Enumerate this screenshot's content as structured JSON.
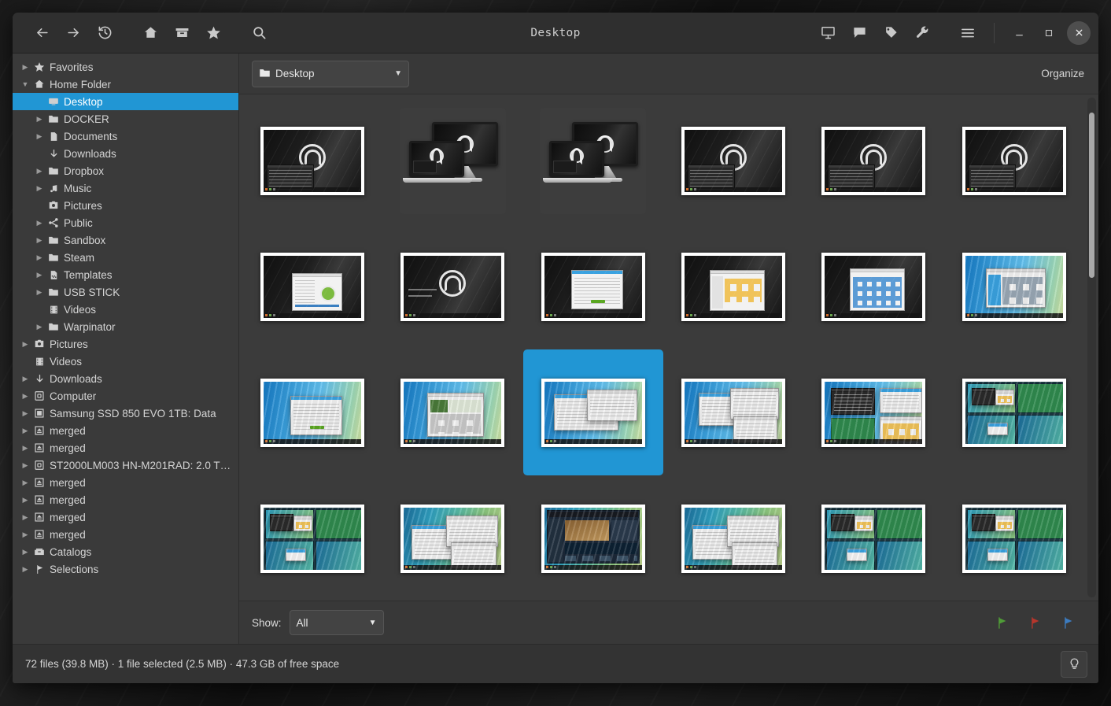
{
  "window": {
    "title": "Desktop",
    "titlebar_left_icons": [
      "back-icon",
      "forward-icon",
      "history-icon",
      "home-icon",
      "archive-icon",
      "star-icon",
      "search-icon"
    ],
    "titlebar_right_icons": [
      "presentation-icon",
      "comment-icon",
      "tag-icon",
      "wrench-icon",
      "menu-icon"
    ],
    "controls": [
      "minimize-button",
      "maximize-button",
      "close-button"
    ]
  },
  "sidebar": {
    "items": [
      {
        "label": "Favorites",
        "icon": "star-icon",
        "indent": 0,
        "arrow": "right",
        "selected": false
      },
      {
        "label": "Home Folder",
        "icon": "home-icon",
        "indent": 0,
        "arrow": "down",
        "selected": false
      },
      {
        "label": "Desktop",
        "icon": "desktop-icon",
        "indent": 1,
        "arrow": "none",
        "selected": true
      },
      {
        "label": "DOCKER",
        "icon": "folder-icon",
        "indent": 1,
        "arrow": "right",
        "selected": false
      },
      {
        "label": "Documents",
        "icon": "document-icon",
        "indent": 1,
        "arrow": "right",
        "selected": false
      },
      {
        "label": "Downloads",
        "icon": "download-icon",
        "indent": 1,
        "arrow": "none",
        "selected": false
      },
      {
        "label": "Dropbox",
        "icon": "folder-icon",
        "indent": 1,
        "arrow": "right",
        "selected": false
      },
      {
        "label": "Music",
        "icon": "music-icon",
        "indent": 1,
        "arrow": "right",
        "selected": false
      },
      {
        "label": "Pictures",
        "icon": "camera-icon",
        "indent": 1,
        "arrow": "none",
        "selected": false
      },
      {
        "label": "Public",
        "icon": "share-icon",
        "indent": 1,
        "arrow": "right",
        "selected": false
      },
      {
        "label": "Sandbox",
        "icon": "folder-icon",
        "indent": 1,
        "arrow": "right",
        "selected": false
      },
      {
        "label": "Steam",
        "icon": "folder-icon",
        "indent": 1,
        "arrow": "right",
        "selected": false
      },
      {
        "label": "Templates",
        "icon": "template-icon",
        "indent": 1,
        "arrow": "right",
        "selected": false
      },
      {
        "label": "USB STICK",
        "icon": "folder-icon",
        "indent": 1,
        "arrow": "right",
        "selected": false
      },
      {
        "label": "Videos",
        "icon": "film-icon",
        "indent": 1,
        "arrow": "none",
        "selected": false
      },
      {
        "label": "Warpinator",
        "icon": "folder-icon",
        "indent": 1,
        "arrow": "right",
        "selected": false
      },
      {
        "label": "Pictures",
        "icon": "camera-icon",
        "indent": 0,
        "arrow": "right",
        "selected": false
      },
      {
        "label": "Videos",
        "icon": "film-icon",
        "indent": 0,
        "arrow": "none",
        "selected": false
      },
      {
        "label": "Downloads",
        "icon": "download-icon",
        "indent": 0,
        "arrow": "right",
        "selected": false
      },
      {
        "label": "Computer",
        "icon": "drive-icon",
        "indent": 0,
        "arrow": "right",
        "selected": false
      },
      {
        "label": "Samsung SSD 850 EVO 1TB: Data",
        "icon": "chip-icon",
        "indent": 0,
        "arrow": "right",
        "selected": false
      },
      {
        "label": "merged",
        "icon": "eject-icon",
        "indent": 0,
        "arrow": "right",
        "selected": false
      },
      {
        "label": "merged",
        "icon": "eject-icon",
        "indent": 0,
        "arrow": "right",
        "selected": false
      },
      {
        "label": "ST2000LM003 HN-M201RAD: 2.0 TB …",
        "icon": "drive-icon",
        "indent": 0,
        "arrow": "right",
        "selected": false
      },
      {
        "label": "merged",
        "icon": "eject-icon",
        "indent": 0,
        "arrow": "right",
        "selected": false
      },
      {
        "label": "merged",
        "icon": "eject-icon",
        "indent": 0,
        "arrow": "right",
        "selected": false
      },
      {
        "label": "merged",
        "icon": "eject-icon",
        "indent": 0,
        "arrow": "right",
        "selected": false
      },
      {
        "label": "merged",
        "icon": "eject-icon",
        "indent": 0,
        "arrow": "right",
        "selected": false
      },
      {
        "label": "Catalogs",
        "icon": "catalog-icon",
        "indent": 0,
        "arrow": "right",
        "selected": false
      },
      {
        "label": "Selections",
        "icon": "flag-icon",
        "indent": 0,
        "arrow": "right",
        "selected": false
      }
    ]
  },
  "pathbar": {
    "current_folder": "Desktop",
    "folder_icon": "folder-icon",
    "organize_label": "Organize"
  },
  "bottombar": {
    "show_label": "Show:",
    "filter_value": "All",
    "flags": [
      {
        "name": "green-flag",
        "color": "#4f9c37"
      },
      {
        "name": "red-flag",
        "color": "#b7362c"
      },
      {
        "name": "blue-flag",
        "color": "#3c7cc0"
      }
    ]
  },
  "statusbar": {
    "text": "72 files (39.8 MB)  ·  1 file selected (2.5 MB)  ·  47.3 GB of free space",
    "tip_icon": "lightbulb-icon"
  },
  "grid": {
    "selected_index": 14,
    "items": [
      {
        "name": "thumbnail-1",
        "kind": "wide",
        "wallpaper": "dark",
        "content": "logo-menu"
      },
      {
        "name": "thumbnail-2",
        "kind": "dev",
        "wallpaper": "dark",
        "content": "devices"
      },
      {
        "name": "thumbnail-3",
        "kind": "dev",
        "wallpaper": "dark",
        "content": "devices"
      },
      {
        "name": "thumbnail-4",
        "kind": "wide",
        "wallpaper": "dark",
        "content": "logo-menu"
      },
      {
        "name": "thumbnail-5",
        "kind": "wide",
        "wallpaper": "dark",
        "content": "logo-menu"
      },
      {
        "name": "thumbnail-6",
        "kind": "wide",
        "wallpaper": "dark",
        "content": "logo-menu"
      },
      {
        "name": "thumbnail-7",
        "kind": "wide",
        "wallpaper": "dark",
        "content": "installer"
      },
      {
        "name": "thumbnail-8",
        "kind": "wide",
        "wallpaper": "dark",
        "content": "logo-only"
      },
      {
        "name": "thumbnail-9",
        "kind": "wide",
        "wallpaper": "dark",
        "content": "dialog-light"
      },
      {
        "name": "thumbnail-10",
        "kind": "wide",
        "wallpaper": "dark",
        "content": "filemanager"
      },
      {
        "name": "thumbnail-11",
        "kind": "wide",
        "wallpaper": "dark",
        "content": "apps-grid"
      },
      {
        "name": "thumbnail-12",
        "kind": "wide",
        "wallpaper": "blue",
        "content": "settings"
      },
      {
        "name": "thumbnail-13",
        "kind": "wide",
        "wallpaper": "blue",
        "content": "dialog-light"
      },
      {
        "name": "thumbnail-14",
        "kind": "wide",
        "wallpaper": "blue",
        "content": "media-browser"
      },
      {
        "name": "thumbnail-15",
        "kind": "wide",
        "wallpaper": "blue",
        "content": "list-window"
      },
      {
        "name": "thumbnail-16",
        "kind": "wide",
        "wallpaper": "blue",
        "content": "dialog-green"
      },
      {
        "name": "thumbnail-17",
        "kind": "wide",
        "wallpaper": "blue",
        "content": "two-panes"
      },
      {
        "name": "thumbnail-18",
        "kind": "wide",
        "wallpaper": "teal",
        "content": "workspaces"
      },
      {
        "name": "thumbnail-19",
        "kind": "wide",
        "wallpaper": "teal",
        "content": "workspaces"
      },
      {
        "name": "thumbnail-20",
        "kind": "wide",
        "wallpaper": "teal",
        "content": "three-windows"
      },
      {
        "name": "thumbnail-21",
        "kind": "wide",
        "wallpaper": "teal",
        "content": "steam"
      },
      {
        "name": "thumbnail-22",
        "kind": "wide",
        "wallpaper": "teal",
        "content": "three-windows"
      },
      {
        "name": "thumbnail-23",
        "kind": "wide",
        "wallpaper": "teal",
        "content": "workspaces"
      },
      {
        "name": "thumbnail-24",
        "kind": "wide",
        "wallpaper": "teal",
        "content": "workspaces"
      }
    ]
  },
  "scrollbar": {
    "name": "vertical-scrollbar",
    "thumb_top_pct": 3,
    "thumb_height_pct": 33
  }
}
